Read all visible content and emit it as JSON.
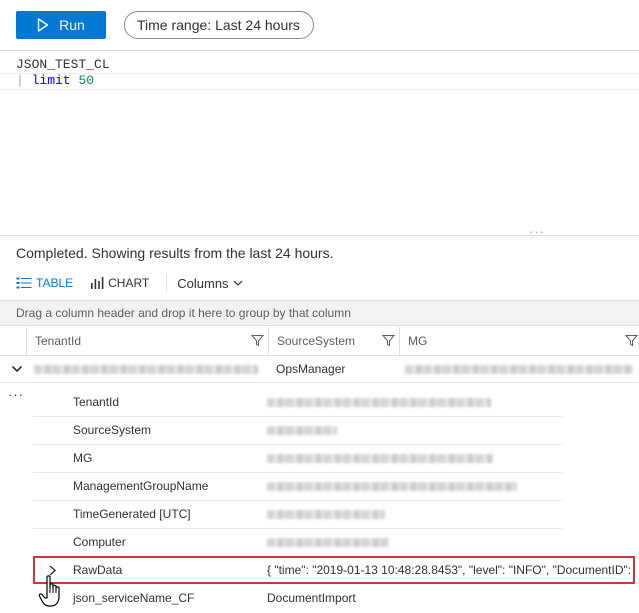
{
  "toolbar": {
    "run_label": "Run",
    "time_range_label": "Time range: Last 24 hours"
  },
  "editor": {
    "line1": "JSON_TEST_CL",
    "line2_pipe": "|",
    "line2_keyword": "limit",
    "line2_number": "50"
  },
  "results": {
    "status": "Completed. Showing results from the last 24 hours.",
    "tabs": [
      {
        "label": "TABLE",
        "icon": "table-icon",
        "active": true
      },
      {
        "label": "CHART",
        "icon": "chart-icon",
        "active": false
      }
    ],
    "columns_label": "Columns",
    "group_hint": "Drag a column header and drop it here to group by that column"
  },
  "grid": {
    "columns": [
      "TenantId",
      "SourceSystem",
      "MG"
    ],
    "row": {
      "SourceSystem": "OpsManager"
    },
    "details": [
      {
        "label": "TenantId",
        "value": ""
      },
      {
        "label": "SourceSystem",
        "value": ""
      },
      {
        "label": "MG",
        "value": ""
      },
      {
        "label": "ManagementGroupName",
        "value": ""
      },
      {
        "label": "TimeGenerated [UTC]",
        "value": ""
      },
      {
        "label": "Computer",
        "value": ""
      },
      {
        "label": "RawData",
        "value": "{ \"time\": \"2019-01-13 10:48:28.8453\", \"level\": \"INFO\", \"DocumentID\":"
      },
      {
        "label": "json_serviceName_CF",
        "value": "DocumentImport"
      }
    ]
  },
  "colors": {
    "accent": "#0078d4",
    "highlight_border": "#d13438",
    "keyword": "#0000ff",
    "number": "#09885a"
  }
}
